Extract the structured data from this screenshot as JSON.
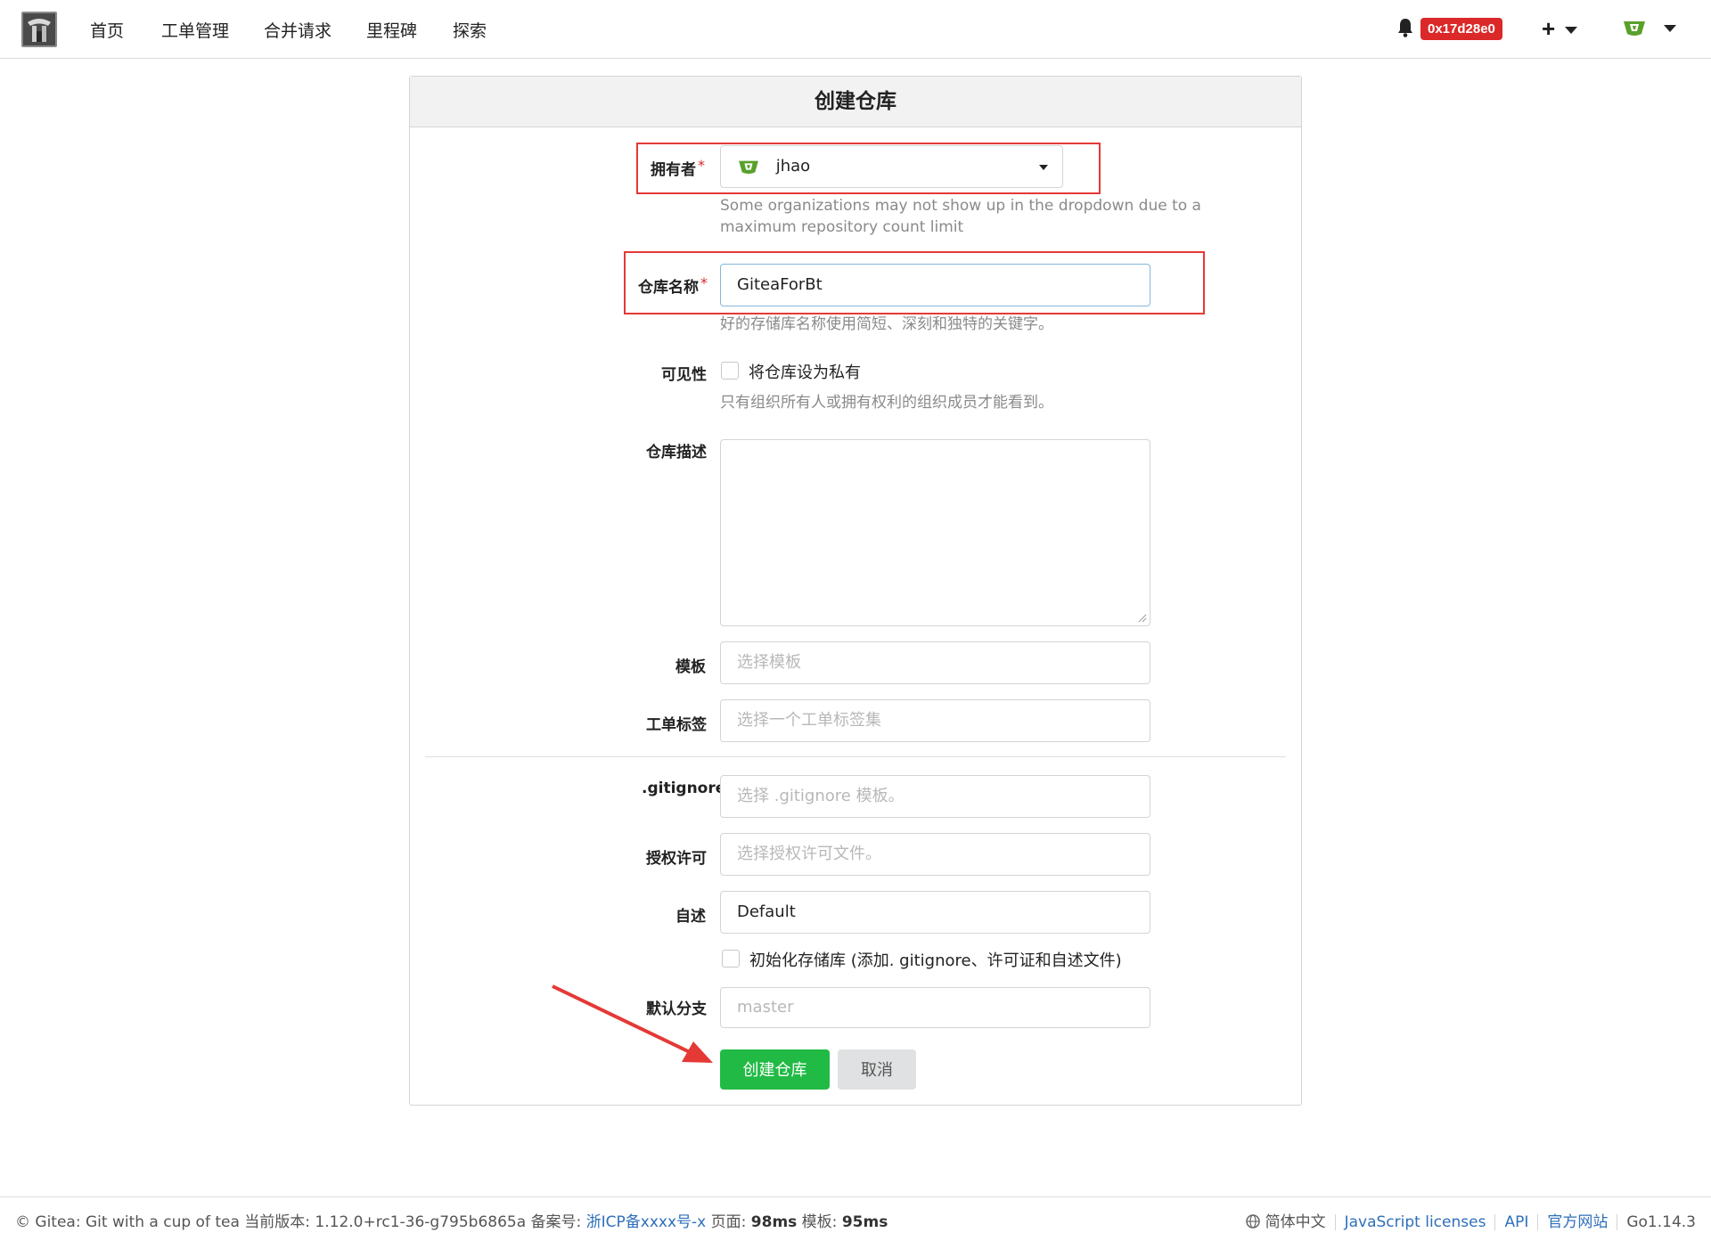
{
  "nav": {
    "links": [
      "首页",
      "工单管理",
      "合并请求",
      "里程碑",
      "探索"
    ],
    "badge": "0x17d28e0",
    "icons": {
      "logo": "gitea-logo",
      "bell": "bell-icon",
      "plus": "plus-icon",
      "avatar": "user-avatar"
    }
  },
  "form": {
    "title": "创建仓库",
    "owner": {
      "label": "拥有者",
      "value": "jhao",
      "help": "Some organizations may not show up in the dropdown due to a maximum repository count limit"
    },
    "repo_name": {
      "label": "仓库名称",
      "value": "GiteaForBt",
      "help": "好的存储库名称使用简短、深刻和独特的关键字。"
    },
    "visibility": {
      "label": "可见性",
      "checkbox_label": "将仓库设为私有",
      "help": "只有组织所有人或拥有权利的组织成员才能看到。"
    },
    "description": {
      "label": "仓库描述",
      "value": ""
    },
    "template": {
      "label": "模板",
      "placeholder": "选择模板"
    },
    "issue_labels": {
      "label": "工单标签",
      "placeholder": "选择一个工单标签集"
    },
    "gitignore": {
      "label": ".gitignore",
      "placeholder": "选择 .gitignore 模板。"
    },
    "license": {
      "label": "授权许可",
      "placeholder": "选择授权许可文件。"
    },
    "readme": {
      "label": "自述",
      "value": "Default"
    },
    "auto_init": {
      "checkbox_label": "初始化存储库 (添加. gitignore、许可证和自述文件)"
    },
    "default_branch": {
      "label": "默认分支",
      "placeholder": "master"
    },
    "submit_label": "创建仓库",
    "cancel_label": "取消"
  },
  "footer": {
    "left_text": "© Gitea: Git with a cup of tea 当前版本: 1.12.0+rc1-36-g795b6865a 备案号: ",
    "icp_link": "浙ICP备xxxx号-x",
    "page_label": " 页面: ",
    "page_time": "98ms",
    "tpl_label": " 模板: ",
    "tpl_time": "95ms",
    "language": "简体中文",
    "js_licenses": "JavaScript licenses",
    "api": "API",
    "website": "官方网站",
    "go_version": "Go1.14.3"
  },
  "colors": {
    "accent_green": "#21ba45",
    "badge_red": "#db2828",
    "annotation_red": "#e53935",
    "link_blue": "#2f6fbb"
  }
}
